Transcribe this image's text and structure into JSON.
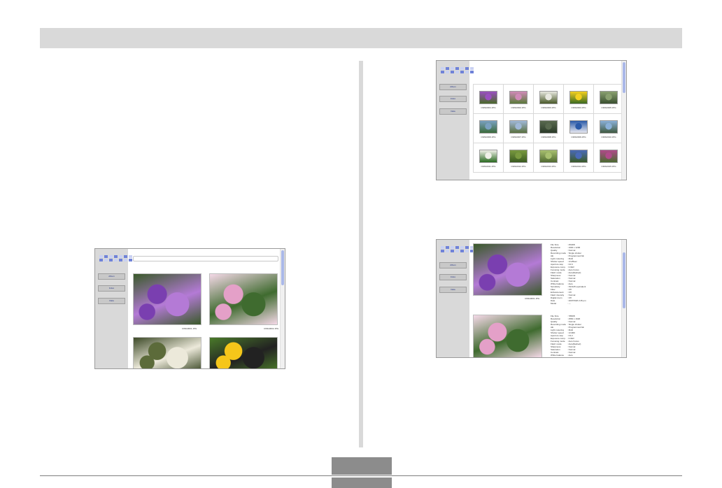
{
  "screenshots": {
    "album": {
      "nav": [
        "Album",
        "Index",
        "Data"
      ],
      "photos": [
        {
          "name": "CIMG0001.JPG",
          "colors": [
            "#7a3fb0",
            "#b47ad6",
            "#3a5a2a"
          ]
        },
        {
          "name": "CIMG0002.JPG",
          "colors": [
            "#e4a0c8",
            "#3f6b2f",
            "#f5d9e8"
          ]
        },
        {
          "name": "",
          "colors": [
            "#5c6b3a",
            "#ece9da",
            "#3d4a28"
          ]
        },
        {
          "name": "",
          "colors": [
            "#f5c61a",
            "#222222",
            "#4a7a2a"
          ]
        }
      ]
    },
    "index": {
      "nav": [
        "Album",
        "Index",
        "Data"
      ],
      "thumbs": [
        {
          "name": "CIMG0001.JPG",
          "c1": "#9a4fc0",
          "c2": "#4a6a2a"
        },
        {
          "name": "CIMG0002.JPG",
          "c1": "#d08ab8",
          "c2": "#5a7a3a"
        },
        {
          "name": "CIMG0003.JPG",
          "c1": "#e8e8e0",
          "c2": "#4a5a2a"
        },
        {
          "name": "CIMG0004.JPG",
          "c1": "#f4d020",
          "c2": "#3a6a20"
        },
        {
          "name": "CIMG0005.JPG",
          "c1": "#8aa070",
          "c2": "#3a5030"
        },
        {
          "name": "CIMG0006.JPG",
          "c1": "#7aa0c0",
          "c2": "#3a6a3a"
        },
        {
          "name": "CIMG0007.JPG",
          "c1": "#a0b8d8",
          "c2": "#5a7040"
        },
        {
          "name": "CIMG0008.JPG",
          "c1": "#5a6a50",
          "c2": "#2a3a28"
        },
        {
          "name": "CIMG0009.JPG",
          "c1": "#2a5aa8",
          "c2": "#e8e8f0"
        },
        {
          "name": "CIMG0010.JPG",
          "c1": "#8ab0d8",
          "c2": "#405a40"
        },
        {
          "name": "CIMG0011.JPG",
          "c1": "#f0f0e8",
          "c2": "#2a6a20"
        },
        {
          "name": "CIMG0012.JPG",
          "c1": "#7a9a40",
          "c2": "#3a5a20"
        },
        {
          "name": "CIMG0013.JPG",
          "c1": "#a8c070",
          "c2": "#506a30"
        },
        {
          "name": "CIMG0014.JPG",
          "c1": "#4a6ab8",
          "c2": "#3a5a28"
        },
        {
          "name": "CIMG0015.JPG",
          "c1": "#b04a8a",
          "c2": "#4a6a30"
        }
      ]
    },
    "data": {
      "nav": [
        "Album",
        "Index",
        "Data"
      ],
      "photo1": {
        "name": "CIMG0001.JPG",
        "colors": [
          "#7a3fb0",
          "#b47ad6",
          "#3a5a2a"
        ]
      },
      "photo2": {
        "name": "",
        "colors": [
          "#e4a0c8",
          "#3f6b2f",
          "#f5d9e8"
        ]
      },
      "meta1": [
        [
          "File Size",
          ": 254KB"
        ],
        [
          "Resolution",
          ": 1600 x 1200"
        ],
        [
          "Quality",
          ": Normal"
        ],
        [
          "Recording mode",
          ": Single shutter"
        ],
        [
          "AE",
          ": Programmed AE"
        ],
        [
          "Light metering",
          ": Multi"
        ],
        [
          "Shutter speed",
          ": 1/125sec"
        ],
        [
          "Aperture stop",
          ": F2.6"
        ],
        [
          "Exposure comp.",
          ": 0.0EV"
        ],
        [
          "Focusing mode",
          ": Auto Focus"
        ],
        [
          "Flash mode",
          ": Auto(flashed)"
        ],
        [
          "Sharpness",
          ": Normal"
        ],
        [
          "Saturation",
          ": Normal"
        ],
        [
          "Contrast",
          ": Normal"
        ],
        [
          "White balance",
          ": Auto"
        ],
        [
          "Sensitivity",
          ": ISO125 equivalent"
        ],
        [
          "Filter",
          ": Off"
        ],
        [
          "Enhancement",
          ": Off"
        ],
        [
          "Flash intensity",
          ": Normal"
        ],
        [
          "Digital zoom",
          ": Off"
        ],
        [
          "Date",
          ": 2007/5/28 2:45 pm"
        ],
        [
          "Model",
          ": ---"
        ]
      ],
      "meta2": [
        [
          "File Size",
          ": 786KB"
        ],
        [
          "Resolution",
          ": 2560 x 1920"
        ],
        [
          "Quality",
          ": Normal"
        ],
        [
          "Recording mode",
          ": Single shutter"
        ],
        [
          "AE",
          ": Programmed AE"
        ],
        [
          "Light metering",
          ": Multi"
        ],
        [
          "Shutter speed",
          ": 1/1000"
        ],
        [
          "Aperture stop",
          ": F3.2"
        ],
        [
          "Exposure comp.",
          ": 0.0EV"
        ],
        [
          "Focusing mode",
          ": Auto Focus"
        ],
        [
          "Flash mode",
          ": Auto(flashed)"
        ],
        [
          "Sharpness",
          ": Normal"
        ],
        [
          "Saturation",
          ": Normal"
        ],
        [
          "Contrast",
          ": Normal"
        ],
        [
          "White balance",
          ": Auto"
        ],
        [
          "Sensitivity",
          ": ISO125 equivalent"
        ]
      ]
    }
  },
  "colors": {
    "header_bar": "#d9d9d9",
    "sidebar": "#d9d9d9",
    "page_tab": "#8c8c8c"
  }
}
